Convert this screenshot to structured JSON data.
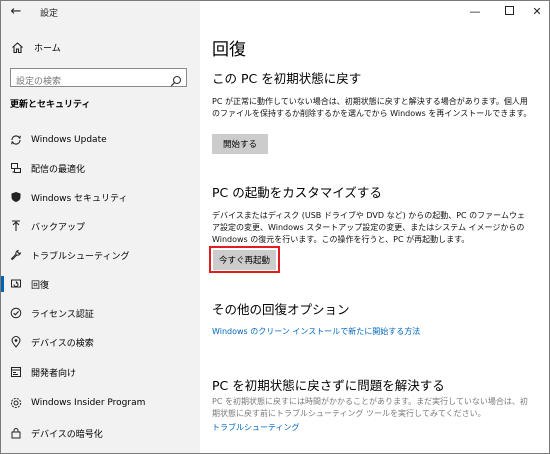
{
  "window": {
    "title": "設定"
  },
  "sidebar": {
    "home_label": "ホーム",
    "search_placeholder": "設定の検索",
    "section_heading": "更新とセキュリティ",
    "items": [
      {
        "label": "Windows Update",
        "icon": "sync-icon"
      },
      {
        "label": "配信の最適化",
        "icon": "delivery-optimization-icon"
      },
      {
        "label": "Windows セキュリティ",
        "icon": "shield-icon"
      },
      {
        "label": "バックアップ",
        "icon": "backup-arrow-icon"
      },
      {
        "label": "トラブルシューティング",
        "icon": "wrench-icon"
      },
      {
        "label": "回復",
        "icon": "recovery-icon",
        "active": true
      },
      {
        "label": "ライセンス認証",
        "icon": "activation-check-icon"
      },
      {
        "label": "デバイスの検索",
        "icon": "find-device-icon"
      },
      {
        "label": "開発者向け",
        "icon": "developer-icon"
      },
      {
        "label": "Windows Insider Program",
        "icon": "insider-icon"
      },
      {
        "label": "デバイスの暗号化",
        "icon": "lock-icon"
      }
    ]
  },
  "main": {
    "page_title": "回復",
    "reset": {
      "heading": "この PC を初期状態に戻す",
      "description": "PC が正常に動作していない場合は、初期状態に戻すと解決する場合があります。個人用のファイルを保持するか削除するかを選んでから Windows を再インストールできます。",
      "button": "開始する"
    },
    "advanced": {
      "heading": "PC の起動をカスタマイズする",
      "description": "デバイスまたはディスク (USB ドライブや DVD など) からの起動、PC のファームウェア設定の変更、Windows スタートアップ設定の変更、またはシステム イメージからの Windows の復元を行います。この操作を行うと、PC が再起動します。",
      "button": "今すぐ再起動"
    },
    "more": {
      "heading": "その他の回復オプション",
      "link": "Windows のクリーン インストールで新たに開始する方法"
    },
    "fix": {
      "heading": "PC を初期状態に戻さずに問題を解決する",
      "description": "PC を初期状態に戻すには時間がかかることがあります。まだ実行していない場合は、初期状態に戻す前にトラブルシューティング ツールを実行してみてください。",
      "link": "トラブルシューティング"
    }
  },
  "colors": {
    "accent": "#0063b1",
    "link": "#0067c0",
    "highlight": "#e01e1e",
    "button": "#cccccc",
    "sidebar_bg": "#f2f2f2"
  }
}
